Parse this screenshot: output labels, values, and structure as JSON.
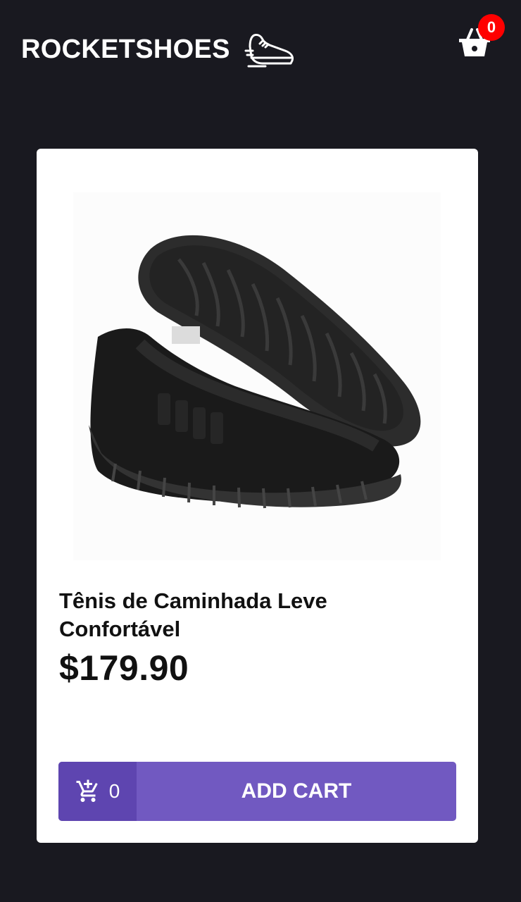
{
  "header": {
    "logo_text": "ROCKETSHOES",
    "logo_icon": "running-shoe-icon",
    "cart_icon": "basket-icon",
    "cart_badge_count": "0"
  },
  "product": {
    "image_icon": "sneaker-photo",
    "title": "Tênis de Caminhada Leve Confortável",
    "price": "$179.90",
    "button": {
      "cart_icon": "add-shopping-cart-icon",
      "count": "0",
      "label": "ADD CART"
    }
  },
  "colors": {
    "background": "#191920",
    "card": "#ffffff",
    "accent": "#7159c1",
    "accent_dark": "#5e45b0",
    "badge": "#ff0000"
  }
}
